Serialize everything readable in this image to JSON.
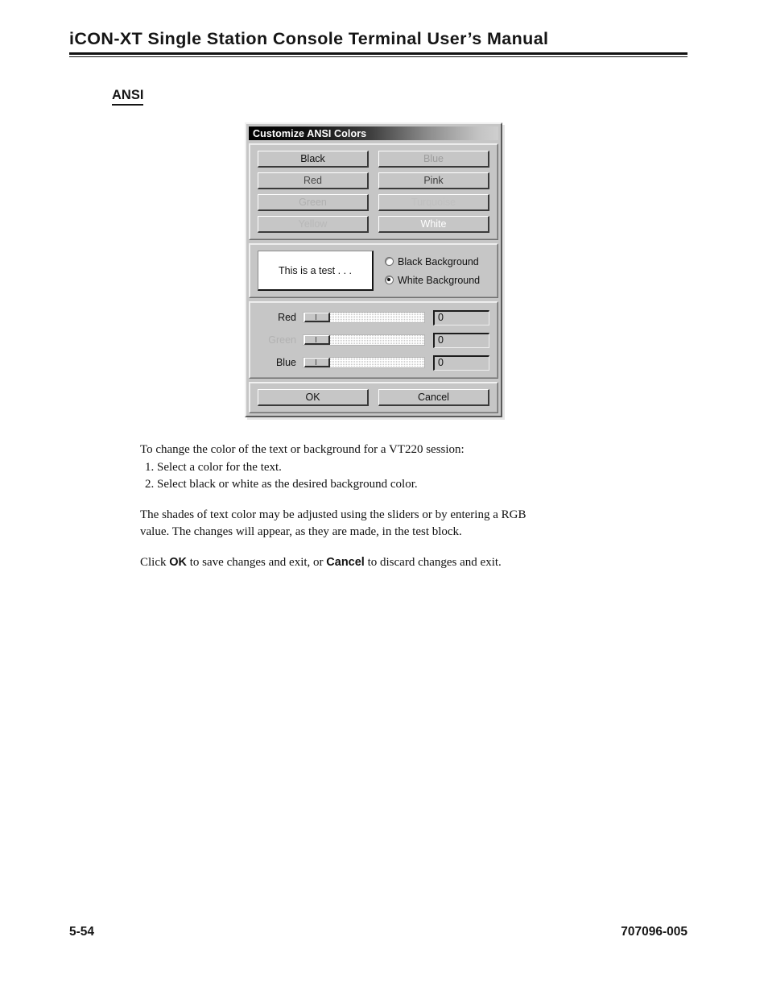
{
  "header": {
    "title": "iCON-XT Single Station Console Terminal User’s Manual"
  },
  "section": {
    "heading": "ANSI"
  },
  "dialog": {
    "title": "Customize ANSI Colors",
    "color_buttons": [
      {
        "label": "Black",
        "state": "enabled"
      },
      {
        "label": "Blue",
        "state": "disabled"
      },
      {
        "label": "Red",
        "state": "enabled"
      },
      {
        "label": "Pink",
        "state": "enabled"
      },
      {
        "label": "Green",
        "state": "disabled"
      },
      {
        "label": "Turquoise",
        "state": "disabled"
      },
      {
        "label": "Yellow",
        "state": "disabled"
      },
      {
        "label": "White",
        "state": "enabled"
      }
    ],
    "preview": {
      "test_text": "This is a test . . ."
    },
    "background_options": [
      {
        "label": "Black Background",
        "selected": false
      },
      {
        "label": "White Background",
        "selected": true
      }
    ],
    "sliders": [
      {
        "label": "Red",
        "value": "0",
        "disabled": false
      },
      {
        "label": "Green",
        "value": "0",
        "disabled": true
      },
      {
        "label": "Blue",
        "value": "0",
        "disabled": false
      }
    ],
    "actions": {
      "ok": "OK",
      "cancel": "Cancel"
    }
  },
  "body": {
    "intro": "To change the color of the text or background for a VT220 session:",
    "step1": "1. Select a color for the text.",
    "step2": "2. Select black or white as the desired background color.",
    "para2_line1": "The shades of text color may be adjusted using the sliders or by entering a RGB",
    "para2_line2": "value. The changes will appear, as they are made, in the test block.",
    "para3_pre": "Click ",
    "para3_ok": "OK",
    "para3_mid": " to save changes and exit, or ",
    "para3_cancel": "Cancel",
    "para3_post": " to discard changes and exit."
  },
  "footer": {
    "page_number": "5-54",
    "document_number": "707096-005"
  }
}
